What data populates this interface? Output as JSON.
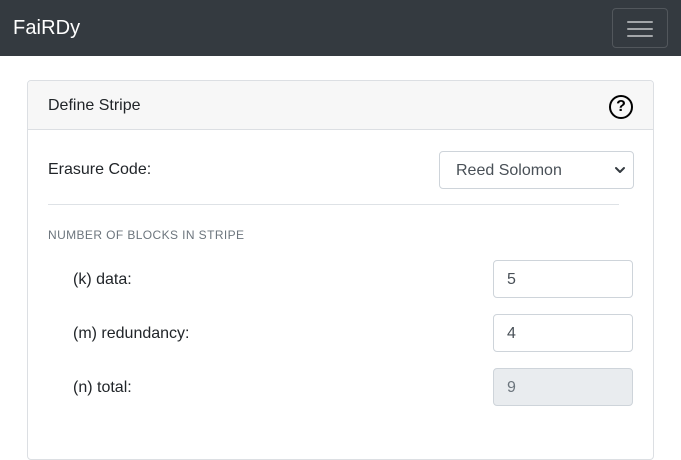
{
  "navbar": {
    "brand": "FaiRDy",
    "menu_icon": "hamburger-menu-icon"
  },
  "card": {
    "title": "Define Stripe",
    "help_icon": "question-circle-icon",
    "help_glyph": "?",
    "erasure": {
      "label": "Erasure Code:",
      "selected": "Reed Solomon"
    },
    "section_title": "NUMBER OF BLOCKS IN STRIPE",
    "k": {
      "label": "(k) data:",
      "value": "5"
    },
    "m": {
      "label": "(m) redundancy:",
      "value": "4"
    },
    "n": {
      "label": "(n) total:",
      "value": "9"
    }
  },
  "colors": {
    "navbar_bg": "#343a40",
    "card_header_bg": "#f7f7f7",
    "readonly_bg": "#e9ecef"
  }
}
